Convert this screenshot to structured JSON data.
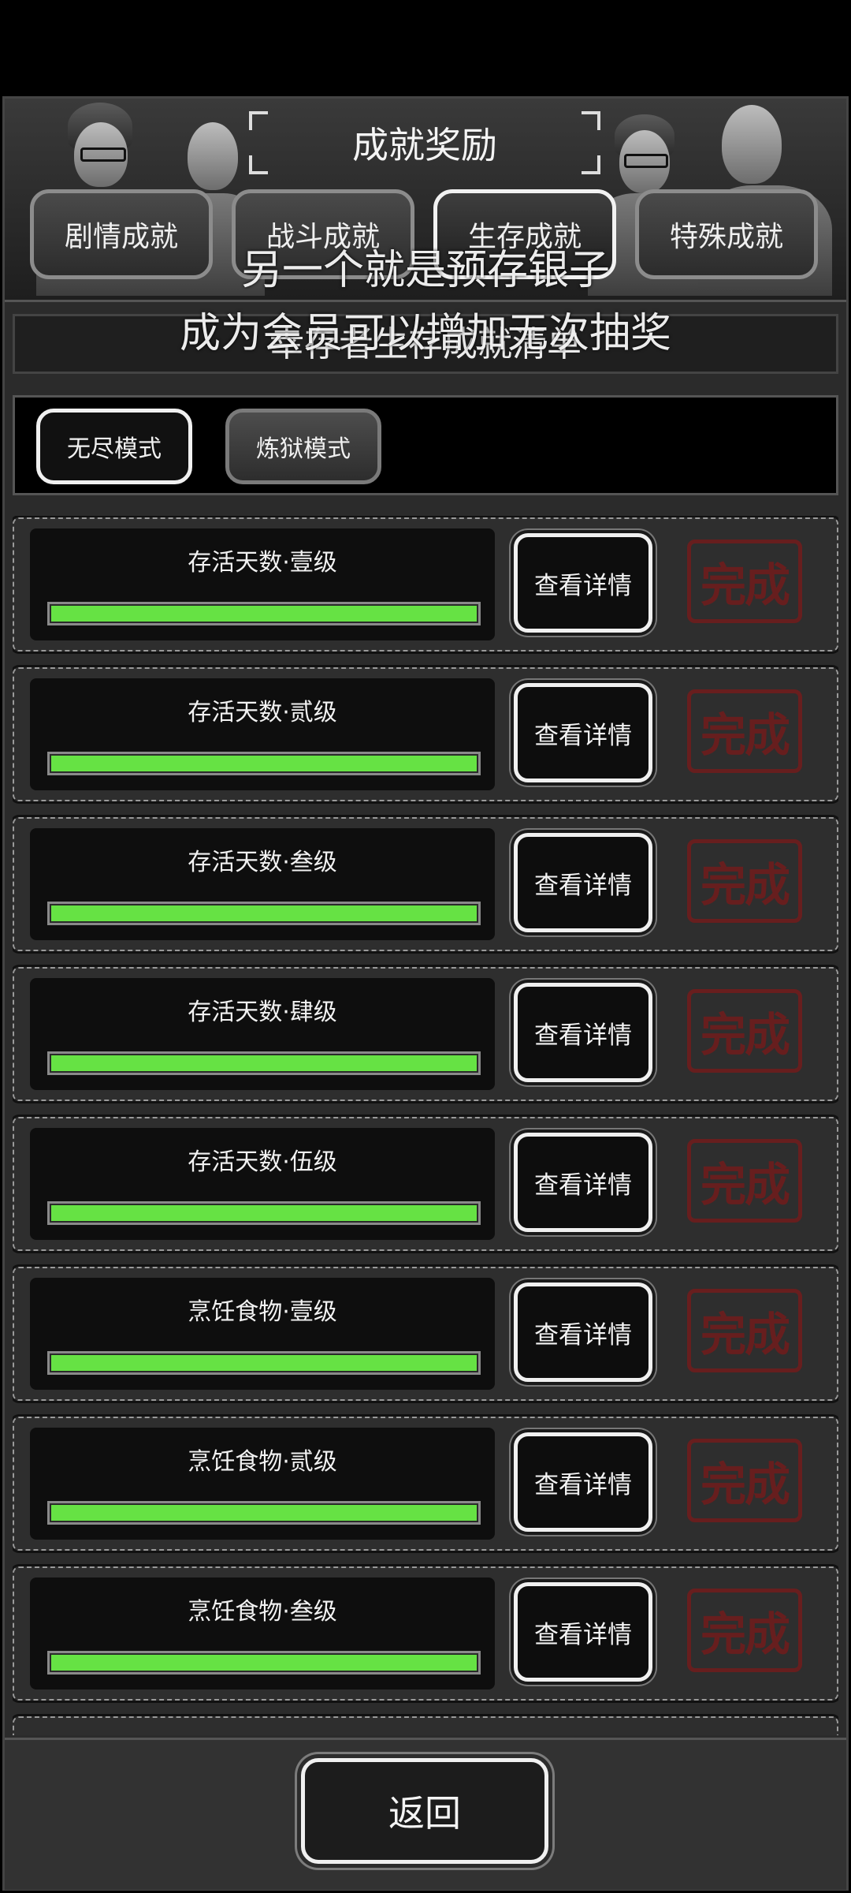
{
  "header": {
    "title": "成就奖励",
    "tabs": [
      {
        "label": "剧情成就",
        "active": false
      },
      {
        "label": "战斗成就",
        "active": false
      },
      {
        "label": "生存成就",
        "active": true
      },
      {
        "label": "特殊成就",
        "active": false
      }
    ]
  },
  "overlay": {
    "line1": "另一个就是预存银子",
    "line2": "成为会员可以增加无次抽奖"
  },
  "subtitle": "幸存者生存成就清单",
  "modes": {
    "endless": "无尽模式",
    "hell": "炼狱模式"
  },
  "achievements": [
    {
      "name": "存活天数·壹级",
      "progress": 1.0,
      "button": "查看详情",
      "stamp": "完成"
    },
    {
      "name": "存活天数·贰级",
      "progress": 1.0,
      "button": "查看详情",
      "stamp": "完成"
    },
    {
      "name": "存活天数·叁级",
      "progress": 1.0,
      "button": "查看详情",
      "stamp": "完成"
    },
    {
      "name": "存活天数·肆级",
      "progress": 1.0,
      "button": "查看详情",
      "stamp": "完成"
    },
    {
      "name": "存活天数·伍级",
      "progress": 1.0,
      "button": "查看详情",
      "stamp": "完成"
    },
    {
      "name": "烹饪食物·壹级",
      "progress": 1.0,
      "button": "查看详情",
      "stamp": "完成"
    },
    {
      "name": "烹饪食物·贰级",
      "progress": 1.0,
      "button": "查看详情",
      "stamp": "完成"
    },
    {
      "name": "烹饪食物·叁级",
      "progress": 1.0,
      "button": "查看详情",
      "stamp": "完成"
    }
  ],
  "footer": {
    "back_label": "返回"
  },
  "colors": {
    "progress_fill": "#66e244",
    "stamp": "#6b1e1e",
    "button_border": "#f0f0f0"
  }
}
